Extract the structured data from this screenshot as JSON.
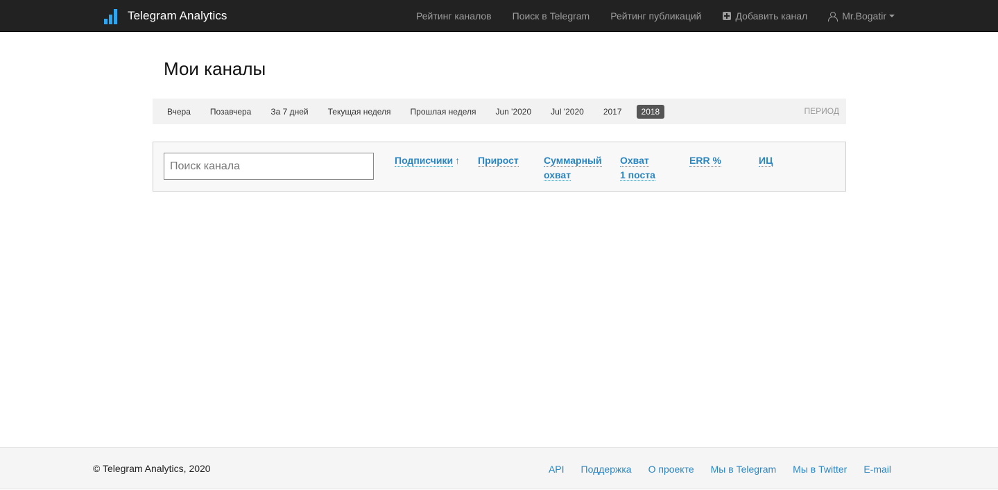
{
  "navbar": {
    "brand": "Telegram Analytics",
    "items": [
      {
        "label": "Рейтинг каналов"
      },
      {
        "label": "Поиск в Telegram"
      },
      {
        "label": "Рейтинг публикаций"
      },
      {
        "label": "Добавить канал",
        "icon": "plus-square-icon"
      },
      {
        "label": "Mr.Bogatir",
        "icon": "user-icon"
      }
    ]
  },
  "page": {
    "title": "Мои каналы"
  },
  "periods": {
    "items": [
      "Вчера",
      "Позавчера",
      "За 7 дней",
      "Текущая неделя",
      "Прошлая неделя",
      "Jun '2020",
      "Jul '2020",
      "2017",
      "2018"
    ],
    "active": "2018",
    "label": "ПЕРИОД"
  },
  "filter": {
    "search_placeholder": "Поиск канала",
    "columns": [
      {
        "line1": "Подписчики",
        "line2": "",
        "arrow": "↑"
      },
      {
        "line1": "Прирост",
        "line2": ""
      },
      {
        "line1": "Суммарный",
        "line2": "охват"
      },
      {
        "line1": "Охват",
        "line2": "1 поста"
      },
      {
        "line1": "ERR %",
        "line2": ""
      },
      {
        "line1": "ИЦ",
        "line2": ""
      }
    ]
  },
  "footer": {
    "copyright": "© Telegram Analytics, 2020",
    "links": [
      "API",
      "Поддержка",
      "О проекте",
      "Мы в Telegram",
      "Мы в Twitter",
      "E-mail"
    ]
  },
  "colors": {
    "navbar_bg": "#222222",
    "brand_accent": "#2ea6ef",
    "link": "#2a86c2",
    "active_period_bg": "#555555"
  }
}
